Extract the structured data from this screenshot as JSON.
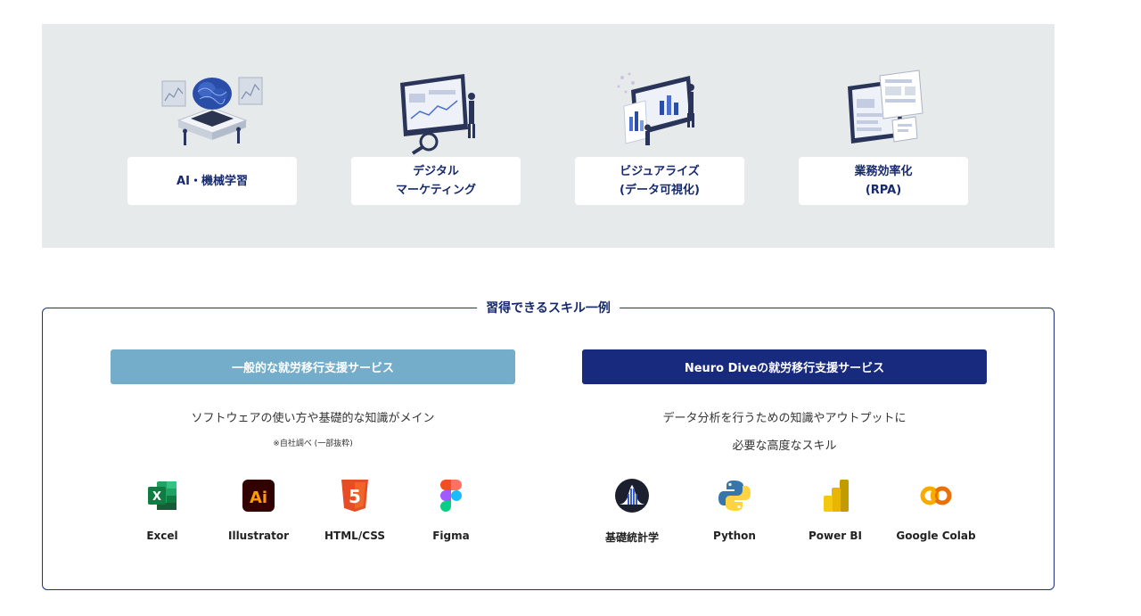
{
  "fields": [
    {
      "icon": "ai-machine-learning-illustration",
      "lines": [
        "AI・機械学習"
      ]
    },
    {
      "icon": "digital-marketing-illustration",
      "lines": [
        "デジタル",
        "マーケティング"
      ]
    },
    {
      "icon": "data-visualization-illustration",
      "lines": [
        "ビジュアライズ",
        "(データ可視化)"
      ]
    },
    {
      "icon": "business-efficiency-illustration",
      "lines": [
        "業務効率化",
        "(RPA)"
      ]
    }
  ],
  "skills": {
    "title": "習得できるスキル一例",
    "general": {
      "header": "一般的な就労移行支援サービス",
      "desc": [
        "ソフトウェアの使い方や基礎的な知識がメイン"
      ],
      "note": "※自社調べ (一部抜粋)",
      "tools": [
        {
          "name": "Excel",
          "icon": "excel-icon"
        },
        {
          "name": "Illustrator",
          "icon": "illustrator-icon"
        },
        {
          "name": "HTML/CSS",
          "icon": "html5-icon"
        },
        {
          "name": "Figma",
          "icon": "figma-icon"
        }
      ]
    },
    "neuro": {
      "header": "Neuro Diveの就労移行支援サービス",
      "desc": [
        "データ分析を行うための知識やアウトプットに",
        "必要な高度なスキル"
      ],
      "tools": [
        {
          "name": "基礎統計学",
          "icon": "statistics-icon"
        },
        {
          "name": "Python",
          "icon": "python-icon"
        },
        {
          "name": "Power BI",
          "icon": "power-bi-icon"
        },
        {
          "name": "Google Colab",
          "icon": "google-colab-icon"
        }
      ]
    }
  },
  "colors": {
    "navy": "#172a7e",
    "light_blue": "#74adc9",
    "panel_gray": "#e6eaea"
  }
}
